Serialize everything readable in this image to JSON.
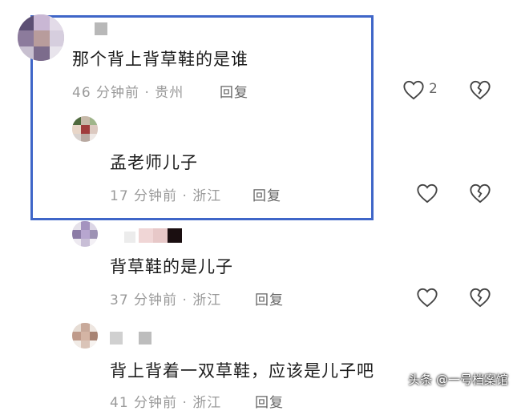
{
  "comments": [
    {
      "text": "那个背上背草鞋的是谁",
      "meta": "46 分钟前 · 贵州",
      "reply": "回复",
      "likes": "2"
    },
    {
      "text": "孟老师儿子",
      "meta": "17 分钟前 · 浙江",
      "reply": "回复"
    },
    {
      "text": "背草鞋的是儿子",
      "meta": "37 分钟前 · 浙江",
      "reply": "回复"
    },
    {
      "text": "背上背着一双草鞋，应该是儿子吧",
      "meta": "41 分钟前 · 浙江",
      "reply": "回复"
    }
  ],
  "icons": {
    "like": "heart-icon",
    "dislike": "broken-heart-icon"
  },
  "watermark": "头条 @一号档案馆",
  "colors": {
    "highlight": "#3f66c8",
    "meta": "#9a9a9a"
  }
}
